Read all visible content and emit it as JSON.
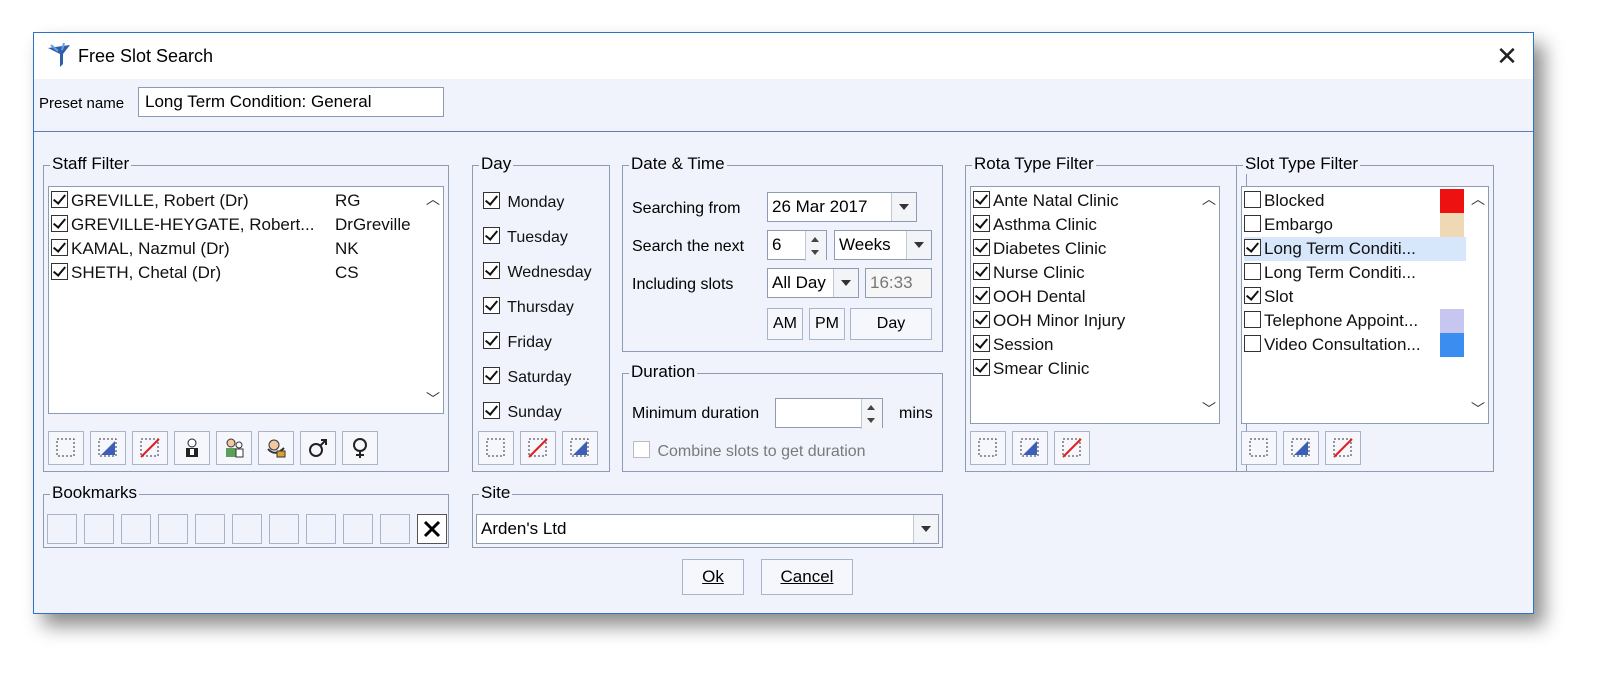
{
  "window": {
    "title": "Free Slot Search"
  },
  "preset": {
    "label": "Preset name",
    "value": "Long Term Condition: General"
  },
  "staff_filter": {
    "title": "Staff Filter",
    "items": [
      {
        "name": "GREVILLE, Robert (Dr)",
        "code": "RG",
        "checked": true
      },
      {
        "name": "GREVILLE-HEYGATE, Robert...",
        "code": "DrGreville",
        "checked": true
      },
      {
        "name": "KAMAL, Nazmul (Dr)",
        "code": "NK",
        "checked": true
      },
      {
        "name": "SHETH, Chetal (Dr)",
        "code": "CS",
        "checked": true
      }
    ],
    "tools": [
      "select-none-icon",
      "select-all-icon",
      "invert-selection-icon",
      "doctor-icon",
      "nurse-icon",
      "staff-search-icon",
      "male-icon",
      "female-icon"
    ]
  },
  "day": {
    "title": "Day",
    "items": [
      {
        "label": "Monday",
        "checked": true
      },
      {
        "label": "Tuesday",
        "checked": true
      },
      {
        "label": "Wednesday",
        "checked": true
      },
      {
        "label": "Thursday",
        "checked": true
      },
      {
        "label": "Friday",
        "checked": true
      },
      {
        "label": "Saturday",
        "checked": true
      },
      {
        "label": "Sunday",
        "checked": true
      }
    ]
  },
  "date_time": {
    "title": "Date & Time",
    "searching_from_label": "Searching from",
    "searching_from_value": "26 Mar 2017",
    "search_next_label": "Search the next",
    "search_next_value": "6",
    "search_next_unit": "Weeks",
    "including_slots_label": "Including slots",
    "including_slots_value": "All Day",
    "time_value": "16:33",
    "am_label": "AM",
    "pm_label": "PM",
    "day_label": "Day"
  },
  "duration": {
    "title": "Duration",
    "min_label": "Minimum duration",
    "min_value": "",
    "unit": "mins",
    "combine_label": "Combine slots to get duration",
    "combine_checked": false
  },
  "rota_filter": {
    "title": "Rota Type Filter",
    "items": [
      {
        "label": "Ante Natal Clinic",
        "checked": true
      },
      {
        "label": "Asthma Clinic",
        "checked": true
      },
      {
        "label": "Diabetes Clinic",
        "checked": true
      },
      {
        "label": "Nurse Clinic",
        "checked": true
      },
      {
        "label": "OOH Dental",
        "checked": true
      },
      {
        "label": "OOH Minor Injury",
        "checked": true
      },
      {
        "label": "Session",
        "checked": true
      },
      {
        "label": "Smear Clinic",
        "checked": true
      }
    ]
  },
  "slot_filter": {
    "title": "Slot Type Filter",
    "items": [
      {
        "label": "Blocked",
        "checked": false,
        "color": "#ee1111"
      },
      {
        "label": "Embargo",
        "checked": false,
        "color": "#efd9b4"
      },
      {
        "label": "Long Term Conditi...",
        "checked": true,
        "color": "",
        "highlight": true
      },
      {
        "label": "Long Term Conditi...",
        "checked": false,
        "color": ""
      },
      {
        "label": "Slot",
        "checked": true,
        "color": ""
      },
      {
        "label": "Telephone Appoint...",
        "checked": false,
        "color": "#c7c6f0"
      },
      {
        "label": "Video Consultation...",
        "checked": false,
        "color": "#3b8eef"
      }
    ]
  },
  "bookmarks": {
    "title": "Bookmarks",
    "slot_count": 10
  },
  "site": {
    "title": "Site",
    "value": "Arden's Ltd"
  },
  "buttons": {
    "ok": "Ok",
    "cancel": "Cancel"
  },
  "colors": {
    "accent": "#2b73c7",
    "panel_bg": "#f0f3fb",
    "selection": "#d6e6fb"
  }
}
